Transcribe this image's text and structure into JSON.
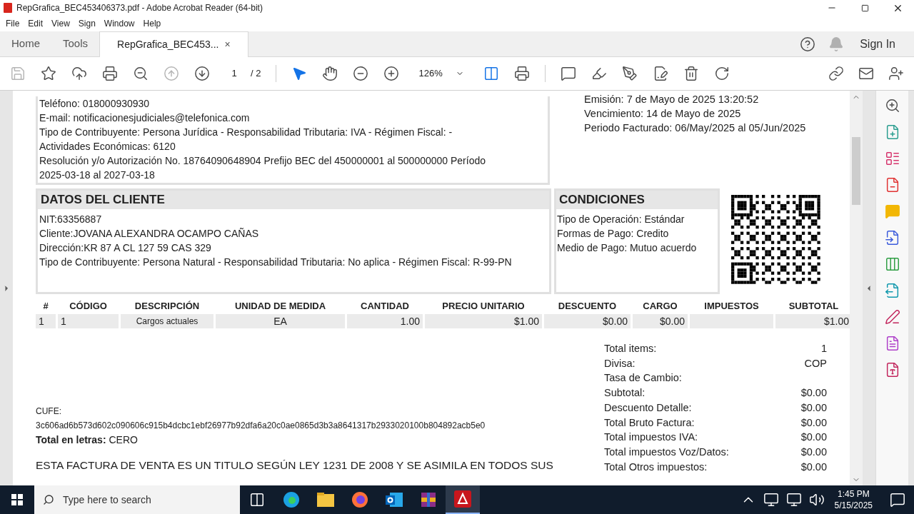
{
  "window": {
    "title": "RepGrafica_BEC453406373.pdf - Adobe Acrobat Reader (64-bit)"
  },
  "menu": [
    "File",
    "Edit",
    "View",
    "Sign",
    "Window",
    "Help"
  ],
  "tabs": [
    {
      "label": "Home",
      "kind": "nav",
      "selected": false
    },
    {
      "label": "Tools",
      "kind": "nav",
      "selected": false
    },
    {
      "label": "RepGrafica_BEC453...",
      "kind": "doc",
      "selected": true,
      "close": "×"
    }
  ],
  "sign_in": "Sign In",
  "toolbar": {
    "page": "1",
    "pages": "/ 2",
    "zoom": "126%"
  },
  "document": {
    "issuer_lines": [
      "Teléfono: 018000930930",
      "E-mail: notificacionesjudiciales@telefonica.com",
      "Tipo de Contribuyente: Persona Jurídica - Responsabilidad Tributaria: IVA - Régimen Fiscal: - Actividades Económicas: 6120",
      "Resolución y/o Autorización No. 18764090648904 Prefijo BEC del 450000001 al 500000000 Período 2025-03-18 al 2027-03-18"
    ],
    "dates": [
      "Emisión: 7 de Mayo de 2025 13:20:52",
      "Vencimiento: 14 de Mayo de 2025",
      "Periodo Facturado: 06/May/2025 al 05/Jun/2025"
    ],
    "client": {
      "title": "DATOS DEL CLIENTE",
      "lines": [
        "NIT:63356887",
        "Cliente:JOVANA ALEXANDRA OCAMPO CAÑAS",
        "Dirección:KR 87 A CL 127 59 CAS 329",
        "Tipo de Contribuyente: Persona Natural - Responsabilidad Tributaria: No aplica - Régimen Fiscal: R-99-PN"
      ]
    },
    "conditions": {
      "title": "CONDICIONES",
      "lines": [
        "Tipo de Operación: Estándar",
        "Formas de Pago: Credito",
        "Medio de Pago: Mutuo acuerdo"
      ]
    },
    "table": {
      "columns": [
        "#",
        "CÓDIGO",
        "DESCRIPCIÓN",
        "UNIDAD DE MEDIDA",
        "CANTIDAD",
        "PRECIO UNITARIO",
        "DESCUENTO",
        "CARGO",
        "IMPUESTOS",
        "SUBTOTAL"
      ],
      "rows": [
        [
          "1",
          "1",
          "Cargos actuales",
          "EA",
          "1.00",
          "$1.00",
          "$0.00",
          "$0.00",
          null,
          "$1.00"
        ]
      ]
    },
    "cufe_label": "CUFE:",
    "cufe": "3c606ad6b573d602c090606c915b4dcbc1ebf26977b92dfa6a20c0ae0865d3b3a8641317b2933020100b804892acb5e0",
    "total_letters": {
      "label": "Total en letras:",
      "value": "CERO"
    },
    "legal": "ESTA FACTURA DE VENTA ES UN TITULO SEGÚN LEY 1231 DE 2008 Y SE ASIMILA EN TODOS SUS",
    "totals": [
      {
        "label": "Total items:",
        "value": "1"
      },
      {
        "label": "Divisa:",
        "value": "COP"
      },
      {
        "label": "Tasa de Cambio:"
      },
      {
        "label": "Subtotal:",
        "value": "$0.00"
      },
      {
        "label": "Descuento Detalle:",
        "value": "$0.00"
      },
      {
        "label": "Total Bruto Factura:",
        "value": "$0.00"
      },
      {
        "label": "Total impuestos IVA:",
        "value": "$0.00"
      },
      {
        "label": "Total impuestos Voz/Datos:",
        "value": "$0.00"
      },
      {
        "label": "Total Otros impuestos:",
        "value": "$0.00"
      }
    ]
  },
  "taskbar": {
    "search_placeholder": "Type here to search",
    "time": "1:45 PM",
    "date": "5/15/2025"
  }
}
